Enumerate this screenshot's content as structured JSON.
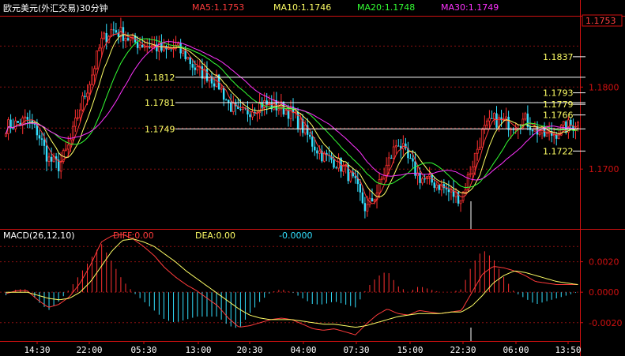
{
  "chart_data": {
    "type": "candlestick",
    "title": "欧元美元(外汇交易)30分钟",
    "indicators": [
      {
        "name": "MA5",
        "label": "MA5:1.1753",
        "color": "#ff3b3b"
      },
      {
        "name": "MA10",
        "label": "MA10:1.1746",
        "color": "#ffff66"
      },
      {
        "name": "MA20",
        "label": "MA20:1.1748",
        "color": "#33ff33"
      },
      {
        "name": "MA30",
        "label": "MA30:1.1749",
        "color": "#ff33ff"
      }
    ],
    "current_price": "1.1753",
    "price_axis": {
      "ticks": [
        "1.1800",
        "1.1700"
      ],
      "ylim": [
        1.1628,
        1.1885
      ]
    },
    "price_levels": [
      {
        "value": 1.1812,
        "label": "1.1812",
        "side": "left"
      },
      {
        "value": 1.1781,
        "label": "1.1781",
        "side": "left"
      },
      {
        "value": 1.1749,
        "label": "1.1749",
        "side": "left"
      },
      {
        "value": 1.1837,
        "label": "1.1837",
        "side": "right"
      },
      {
        "value": 1.1793,
        "label": "1.1793",
        "side": "right"
      },
      {
        "value": 1.1779,
        "label": "1.1779",
        "side": "right"
      },
      {
        "value": 1.1766,
        "label": "1.1766",
        "side": "right"
      },
      {
        "value": 1.1722,
        "label": "1.1722",
        "side": "right"
      }
    ],
    "anchors": [
      1.1752,
      1.1755,
      1.176,
      1.1745,
      1.1712,
      1.1704,
      1.173,
      1.1775,
      1.181,
      1.1855,
      1.187,
      1.1865,
      1.1855,
      1.1852,
      1.185,
      1.1843,
      1.1848,
      1.1838,
      1.182,
      1.1815,
      1.1805,
      1.178,
      1.1765,
      1.1772,
      1.178,
      1.1778,
      1.1775,
      1.1768,
      1.175,
      1.173,
      1.1715,
      1.171,
      1.17,
      1.168,
      1.165,
      1.1672,
      1.1705,
      1.1735,
      1.171,
      1.169,
      1.1685,
      1.168,
      1.167,
      1.1665,
      1.1705,
      1.1745,
      1.176,
      1.1757,
      1.1755,
      1.176,
      1.1748,
      1.174,
      1.1745,
      1.1752,
      1.1755
    ],
    "macd": {
      "label": "MACD(26,12,10)",
      "diff_label": "DIFF:0.00",
      "dea_label": "DEA:0.00",
      "hist_label": "-0.0000",
      "ticks": [
        "0.0020",
        "0.0000",
        "-0.0020"
      ],
      "ylim": [
        -0.0031,
        0.004
      ],
      "diff": [
        -0.0001,
        0.0001,
        0.0001,
        -0.0005,
        -0.001,
        -0.0008,
        -0.0003,
        0.0006,
        0.0018,
        0.0033,
        0.0037,
        0.0038,
        0.0035,
        0.003,
        0.0024,
        0.0016,
        0.001,
        0.0005,
        0.0001,
        -0.0004,
        -0.0009,
        -0.0017,
        -0.0023,
        -0.0022,
        -0.002,
        -0.0018,
        -0.0017,
        -0.0018,
        -0.0021,
        -0.0024,
        -0.0025,
        -0.0024,
        -0.0026,
        -0.0028,
        -0.0021,
        -0.0015,
        -0.0011,
        -0.0014,
        -0.0015,
        -0.0012,
        -0.0013,
        -0.0014,
        -0.0013,
        -0.0012,
        0.0,
        0.0012,
        0.0017,
        0.0016,
        0.0014,
        0.0011,
        0.0007,
        0.0006,
        0.0005,
        0.0005,
        0.0005
      ],
      "dea": [
        0.0,
        0.0,
        0.0,
        -0.0002,
        -0.0004,
        -0.0005,
        -0.0004,
        0.0,
        0.0007,
        0.0017,
        0.0027,
        0.0034,
        0.0035,
        0.0033,
        0.003,
        0.0025,
        0.002,
        0.0014,
        0.0009,
        0.0004,
        -0.0001,
        -0.0006,
        -0.0011,
        -0.0015,
        -0.0017,
        -0.0018,
        -0.0018,
        -0.0018,
        -0.0019,
        -0.002,
        -0.0021,
        -0.0021,
        -0.0022,
        -0.0023,
        -0.0022,
        -0.002,
        -0.0018,
        -0.0016,
        -0.0015,
        -0.0014,
        -0.0014,
        -0.0014,
        -0.0013,
        -0.0013,
        -0.0009,
        -0.0002,
        0.0006,
        0.0011,
        0.0014,
        0.0013,
        0.0011,
        0.0009,
        0.0007,
        0.0006,
        0.0005
      ]
    },
    "x_ticks": [
      "14:30",
      "22:00",
      "05:30",
      "13:00",
      "20:30",
      "04:00",
      "07:30",
      "15:00",
      "22:30",
      "06:00",
      "13:50"
    ],
    "grid": true,
    "legend": "top"
  }
}
